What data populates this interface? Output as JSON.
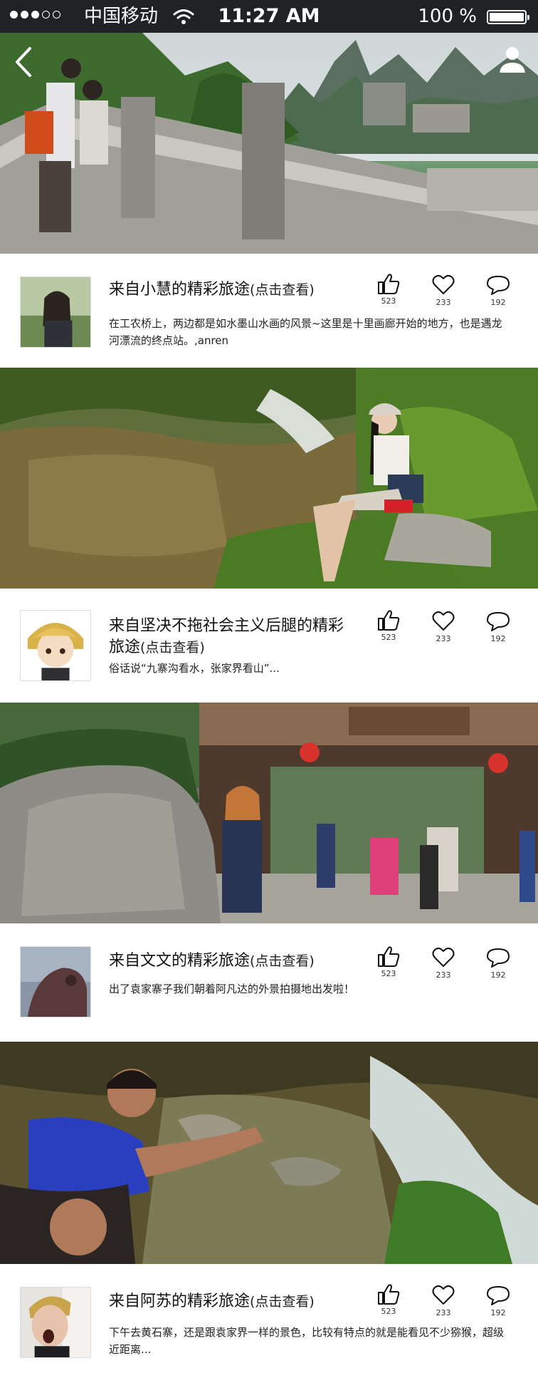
{
  "status_bar": {
    "carrier": "中国移动",
    "time": "11:27 AM",
    "battery_label": "100 %",
    "signal_dots_filled": 3,
    "signal_dots_total": 5
  },
  "nav": {
    "back_icon": "chevron-left-icon",
    "user_icon": "user-icon"
  },
  "posts": [
    {
      "title_main": "来自小慧的精彩旅途",
      "title_hint": "(点击查看)",
      "description": "在工农桥上，两边都是如水墨山水画的风景~这里是十里画廊开始的地方，也是遇龙河漂流的终点站。,anren",
      "likes": "523",
      "favorites": "233",
      "comments": "192"
    },
    {
      "title_main": "来自坚决不拖社会主义后腿的精彩旅途",
      "title_hint": "(点击查看)",
      "description": "俗话说“九寨沟看水，张家界看山”...",
      "likes": "523",
      "favorites": "233",
      "comments": "192"
    },
    {
      "title_main": "来自文文的精彩旅途",
      "title_hint": "(点击查看)",
      "description": "出了袁家寨子我们朝着阿凡达的外景拍摄地出发啦！",
      "likes": "523",
      "favorites": "233",
      "comments": "192"
    },
    {
      "title_main": "来自阿苏的精彩旅途",
      "title_hint": "(点击查看)",
      "description": "下午去黄石寨，还是跟袁家界一样的景色，比较有特点的就是能看见不少猕猴，超级近距离...",
      "likes": "523",
      "favorites": "233",
      "comments": "192"
    }
  ],
  "colors": {
    "status_bar_bg": "#1f2326",
    "card_bg": "#ffffff",
    "text": "#111111"
  }
}
